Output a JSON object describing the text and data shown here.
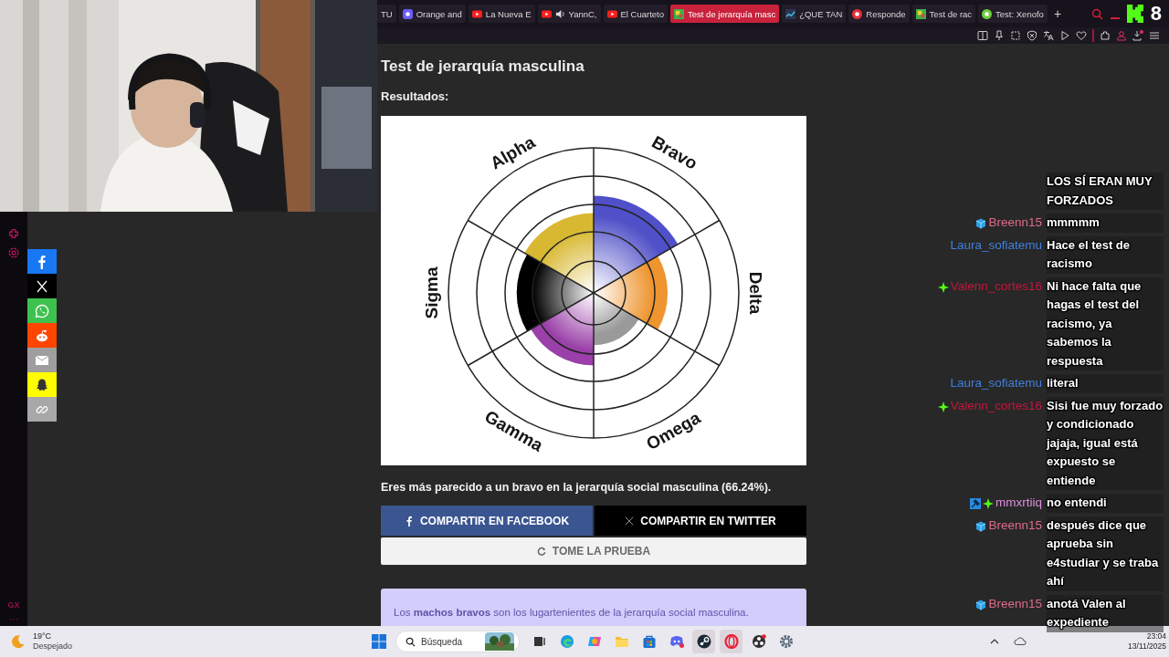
{
  "tabs": [
    {
      "title": "TU",
      "kind": "none",
      "audio": false,
      "selected": false
    },
    {
      "title": "Orange and",
      "kind": "app",
      "audio": false,
      "selected": false
    },
    {
      "title": "La Nueva E",
      "kind": "play",
      "audio": false,
      "selected": false
    },
    {
      "title": "YannC,",
      "kind": "play",
      "audio": true,
      "selected": false
    },
    {
      "title": "El Cuarteto",
      "kind": "play",
      "audio": false,
      "selected": false
    },
    {
      "title": "Test de jerarquía masc",
      "kind": "grid",
      "audio": false,
      "selected": true
    },
    {
      "title": "¿QUE TAN",
      "kind": "chart",
      "audio": false,
      "selected": false
    },
    {
      "title": "Responde",
      "kind": "round",
      "color": "#e0303a",
      "audio": false,
      "selected": false
    },
    {
      "title": "Test de rac",
      "kind": "grid",
      "audio": false,
      "selected": false
    },
    {
      "title": "Test: Xenofo",
      "kind": "round",
      "color": "#6ccf3a",
      "audio": false,
      "selected": false
    }
  ],
  "new_tab": "+",
  "stream_counter": "8",
  "sidebar": {
    "logo": "GX",
    "more": "···"
  },
  "share": [
    {
      "kind": "facebook",
      "color": "#1877f2"
    },
    {
      "kind": "x",
      "color": "#000000"
    },
    {
      "kind": "whatsapp",
      "color": "#3ec14e"
    },
    {
      "kind": "reddit",
      "color": "#ff4500"
    },
    {
      "kind": "email",
      "color": "#9e9e9e"
    },
    {
      "kind": "snapchat",
      "color": "#fffc00"
    },
    {
      "kind": "link",
      "color": "#a8a8a8"
    }
  ],
  "page": {
    "title": "Test de jerarquía masculina",
    "results_label": "Resultados:",
    "chart": {
      "sectors": [
        {
          "label": "Bravo",
          "color": "#5050c8",
          "level": 0.67
        },
        {
          "label": "Delta",
          "color": "#ee9530",
          "level": 0.51
        },
        {
          "label": "Omega",
          "color": "#9a9a9a",
          "level": 0.36
        },
        {
          "label": "Gamma",
          "color": "#9a40a8",
          "level": 0.5
        },
        {
          "label": "Sigma",
          "color": "#000000",
          "level": 0.53
        },
        {
          "label": "Alpha",
          "color": "#d8b830",
          "level": 0.55
        }
      ]
    },
    "result": "Eres más parecido a un bravo en la jerarquía social masculina (66.24%).",
    "buttons": [
      {
        "kind": "facebook",
        "label": "COMPARTIR EN FACEBOOK"
      },
      {
        "kind": "twitter",
        "label": "COMPARTIR EN TWITTER"
      },
      {
        "kind": "retake",
        "label": "TOME LA PRUEBA"
      }
    ],
    "info": "Los **machos bravos** son los lugartenientes de la jerarquía social masculina."
  },
  "chat": [
    {
      "text": "LOS SÍ ERAN MUY FORZADOS"
    },
    {
      "user": "Breenn15",
      "color": "#e06a8a",
      "badges": [
        {
          "kind": "sub"
        }
      ],
      "text": "mmmmm"
    },
    {
      "user": "Laura_sofiatemu",
      "color": "#3f7fdc",
      "text": "Hace el test de racismo"
    },
    {
      "user": "Valenn_cortes16",
      "color": "#c8143c",
      "badges": [
        {
          "kind": "plus"
        }
      ],
      "text": "Ni hace falta que hagas el test del racismo, ya sabemos la respuesta"
    },
    {
      "user": "Laura_sofiatemu",
      "color": "#3f7fdc",
      "text": "literal"
    },
    {
      "user": "Valenn_cortes16",
      "color": "#c8143c",
      "badges": [
        {
          "kind": "plus"
        }
      ],
      "text": "Sisi fue muy forzado y condicionado jajaja, igual está expuesto se entiende"
    },
    {
      "user": "mmxrtiiq",
      "color": "#dd8ede",
      "badges": [
        {
          "kind": "mod"
        },
        {
          "kind": "plus"
        }
      ],
      "text": "no entendi"
    },
    {
      "user": "Breenn15",
      "color": "#e06a8a",
      "badges": [
        {
          "kind": "sub"
        }
      ],
      "text": "después dice que aprueba sin e4studiar y se traba ahí"
    },
    {
      "user": "Breenn15",
      "color": "#e06a8a",
      "badges": [
        {
          "kind": "sub"
        }
      ],
      "text": "anotá Valen al expediente"
    }
  ],
  "taskbar": {
    "temperature": "19°C",
    "weather": "Despejado",
    "search_placeholder": "Búsqueda",
    "apps": [
      {
        "kind": "taskview",
        "active": false
      },
      {
        "kind": "edge",
        "active": false
      },
      {
        "kind": "copilot",
        "active": false
      },
      {
        "kind": "folder",
        "active": false
      },
      {
        "kind": "store",
        "active": false
      },
      {
        "kind": "discord",
        "active": false
      },
      {
        "kind": "steam",
        "active": true
      },
      {
        "kind": "opera",
        "active": true
      },
      {
        "kind": "obs",
        "active": false
      },
      {
        "kind": "settings",
        "active": false
      }
    ],
    "time": "23:04",
    "date": "13/11/2025"
  }
}
